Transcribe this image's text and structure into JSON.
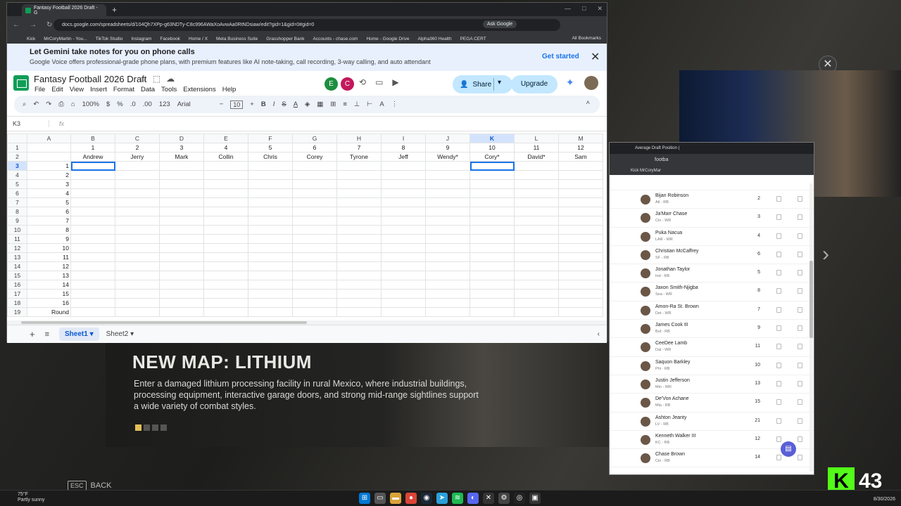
{
  "browser": {
    "tab_title": "Fantasy Football 2026 Draft - G",
    "url": "docs.google.com/spreadsheets/d/104Qh7XPp-g63NDTy-C8c996AWaXoAvwAa0RtNDsiaw/edit?gid=1&gid=0#gid=0",
    "ask_google": "Ask Google",
    "bookmarks": [
      "Kick",
      "MrCoryMartin - You...",
      "TikTok Studio",
      "Instagram",
      "Facebook",
      "Home / X",
      "Meta Business Suite",
      "Grasshopper Bank",
      "Accounts - chase.com",
      "Home - Google Drive",
      "Alpha360 Health",
      "PEGA CERT"
    ],
    "all_bookmarks": "All Bookmarks"
  },
  "gemini_banner": {
    "title": "Let Gemini take notes for you on phone calls",
    "body": "Google Voice offers professional-grade phone plans, with premium features like AI note-taking, call recording, 3-way calling, and auto attendant",
    "cta": "Get started"
  },
  "doc": {
    "title": "Fantasy Football 2026 Draft",
    "menu": [
      "File",
      "Edit",
      "View",
      "Insert",
      "Format",
      "Data",
      "Tools",
      "Extensions",
      "Help"
    ],
    "avatar_e": "E",
    "avatar_c": "C",
    "share": "Share",
    "upgrade": "Upgrade"
  },
  "toolbar": {
    "zoom": "100%",
    "currency": "$",
    "percent": "%",
    "dec_less": ".0",
    "dec_more": ".00",
    "num_fmt": "123",
    "font": "Arial",
    "font_size": "10"
  },
  "formula_bar": {
    "cell_ref": "K3",
    "fx": "fx"
  },
  "grid": {
    "columns": [
      "A",
      "B",
      "C",
      "D",
      "E",
      "F",
      "G",
      "H",
      "I",
      "J",
      "K",
      "L",
      "M"
    ],
    "row1": [
      "",
      "1",
      "2",
      "3",
      "4",
      "5",
      "6",
      "7",
      "8",
      "9",
      "10",
      "11",
      "12"
    ],
    "row2": [
      "",
      "Andrew",
      "Jerry",
      "Mark",
      "Collin",
      "Chris",
      "Corey",
      "Tyrone",
      "Jeff",
      "Wendy*",
      "Cory*",
      "David*",
      "Sam"
    ],
    "row_numbers": [
      "1",
      "2",
      "3",
      "4",
      "5",
      "6",
      "7",
      "8",
      "9",
      "10",
      "11",
      "12",
      "13",
      "14",
      "15",
      "16",
      "17",
      "18",
      "19"
    ],
    "col_a": [
      "",
      "",
      "1",
      "2",
      "3",
      "4",
      "5",
      "6",
      "7",
      "8",
      "9",
      "10",
      "11",
      "12",
      "13",
      "14",
      "15",
      "16",
      "Round"
    ]
  },
  "sheets": {
    "tab1": "Sheet1",
    "tab2": "Sheet2"
  },
  "game": {
    "title": "NEW MAP: LITHIUM",
    "desc": "Enter a damaged lithium processing facility in rural Mexico, where industrial buildings, processing equipment, interactive garage doors, and strong mid-range sightlines support a wide variety of combat styles.",
    "back": "BACK",
    "esc": "ESC"
  },
  "adp": {
    "tab_title": "Average Draft Position (",
    "addr": "footba",
    "bookmark": "Kick  MrCoryMar",
    "players": [
      {
        "name": "Bijan Robinson",
        "team": "Atl - RB",
        "rank": "2"
      },
      {
        "name": "Ja'Marr Chase",
        "team": "Cin - WR",
        "rank": "3"
      },
      {
        "name": "Puka Nacua",
        "team": "LAR - WR",
        "rank": "4"
      },
      {
        "name": "Christian McCaffrey",
        "team": "SF - RB",
        "rank": "6"
      },
      {
        "name": "Jonathan Taylor",
        "team": "Ind - RB",
        "rank": "5"
      },
      {
        "name": "Jaxon Smith-Njigba",
        "team": "Sea - WR",
        "rank": "8"
      },
      {
        "name": "Amon-Ra St. Brown",
        "team": "Det - WR",
        "rank": "7"
      },
      {
        "name": "James Cook III",
        "team": "Buf - RB",
        "rank": "9"
      },
      {
        "name": "CeeDee Lamb",
        "team": "Dal - WR",
        "rank": "11"
      },
      {
        "name": "Saquon Barkley",
        "team": "Phi - RB",
        "rank": "10"
      },
      {
        "name": "Justin Jefferson",
        "team": "Min - WR",
        "rank": "13"
      },
      {
        "name": "De'Von Achane",
        "team": "Mia - RB",
        "rank": "15"
      },
      {
        "name": "Ashton Jeanty",
        "team": "LV - RB",
        "rank": "21"
      },
      {
        "name": "Kenneth Walker III",
        "team": "KC - RB",
        "rank": "12"
      },
      {
        "name": "Chase Brown",
        "team": "Cin - RB",
        "rank": "14"
      }
    ]
  },
  "stream": {
    "viewers": "43"
  },
  "taskbar": {
    "weather_temp": "75°F",
    "weather_desc": "Partly sunny",
    "date": "8/30/2026"
  }
}
